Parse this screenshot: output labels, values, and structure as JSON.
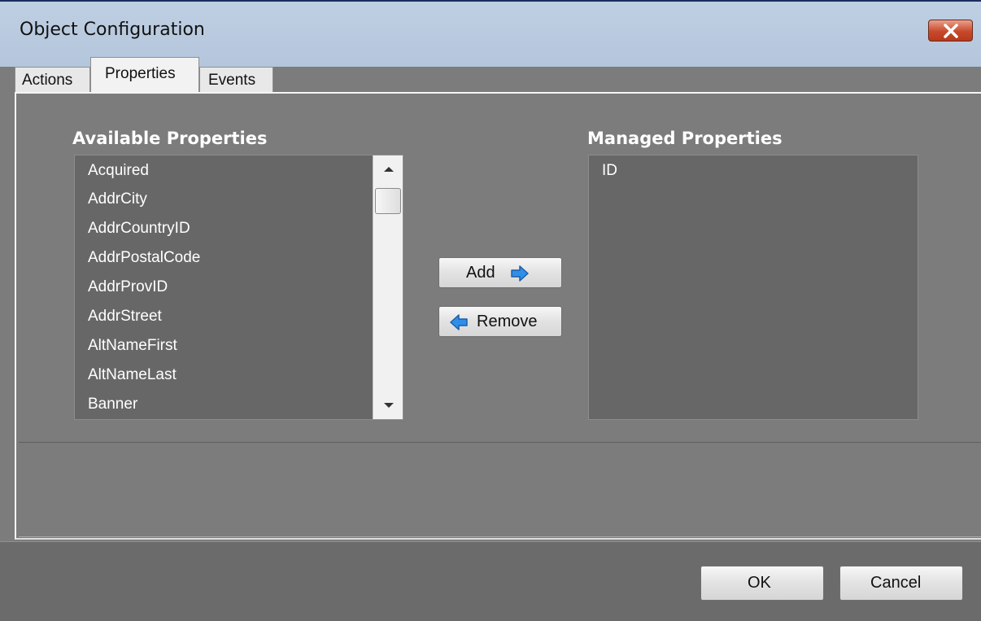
{
  "window": {
    "title": "Object Configuration"
  },
  "tabs": [
    {
      "label": "Actions",
      "active": false
    },
    {
      "label": "Properties",
      "active": true
    },
    {
      "label": "Events",
      "active": false
    }
  ],
  "available": {
    "label": "Available Properties",
    "items": [
      "Acquired",
      "AddrCity",
      "AddrCountryID",
      "AddrPostalCode",
      "AddrProvID",
      "AddrStreet",
      "AltNameFirst",
      "AltNameLast",
      "Banner"
    ]
  },
  "managed": {
    "label": "Managed Properties",
    "items": [
      "ID"
    ]
  },
  "buttons": {
    "add": "Add",
    "remove": "Remove",
    "ok": "OK",
    "cancel": "Cancel"
  },
  "icons": {
    "add": "arrow-right-icon",
    "remove": "arrow-left-icon",
    "close": "close-icon"
  },
  "colors": {
    "arrow": "#2f8fe8",
    "close": "#c8492c"
  }
}
